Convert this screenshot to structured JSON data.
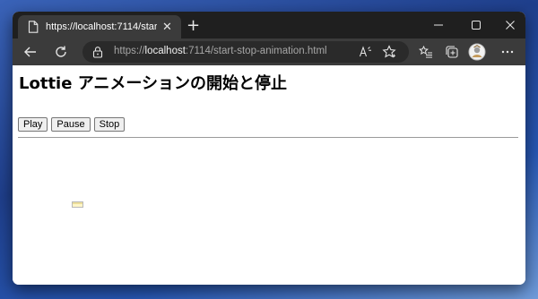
{
  "browser": {
    "tab": {
      "title": "https://localhost:7114/start-stop",
      "close_glyph": "✕",
      "icon": "page-icon"
    },
    "new_tab_glyph": "+",
    "window_controls": {
      "minimize": "minimize-icon",
      "maximize": "maximize-icon",
      "close": "close-icon"
    },
    "address": {
      "scheme": "https://",
      "host": "localhost",
      "rest": ":7114/start-stop-animation.html"
    },
    "toolbar_icons": [
      "back-icon",
      "refresh-icon",
      "read-aloud-icon",
      "favorite-icon",
      "favorites-list-icon",
      "collections-icon",
      "profile-icon",
      "more-icon"
    ],
    "colors": {
      "titlebar": "#1f1f1f",
      "toolbar": "#3b3b3b",
      "address_bg": "#2a2a2a"
    }
  },
  "page": {
    "heading": "Lottie アニメーションの開始と停止",
    "buttons": {
      "play": "Play",
      "pause": "Pause",
      "stop": "Stop"
    },
    "animation_icon": "lottie-animation-placeholder"
  }
}
